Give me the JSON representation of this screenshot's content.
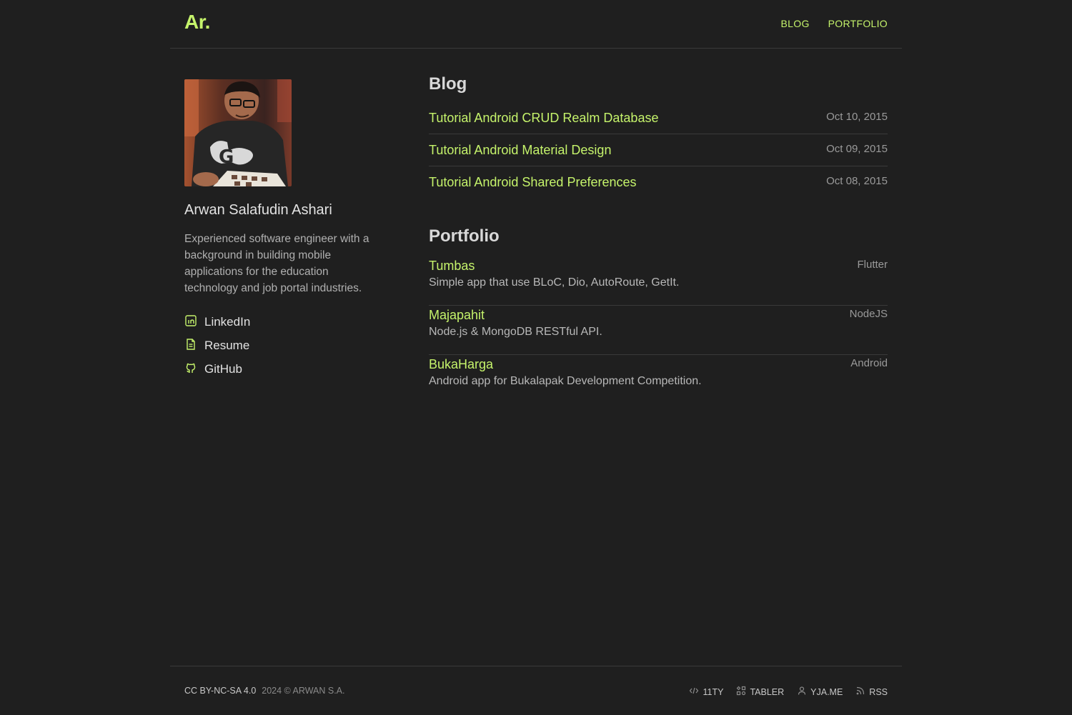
{
  "header": {
    "logo": "Ar.",
    "nav": [
      {
        "label": "BLOG"
      },
      {
        "label": "PORTFOLIO"
      }
    ]
  },
  "profile": {
    "name": "Arwan Salafudin Ashari",
    "bio": "Experienced software engineer with a background in building mobile applications for the education technology and job portal industries.",
    "links": [
      {
        "label": "LinkedIn",
        "icon": "linkedin-icon"
      },
      {
        "label": "Resume",
        "icon": "file-text-icon"
      },
      {
        "label": "GitHub",
        "icon": "github-icon"
      }
    ]
  },
  "blog": {
    "title": "Blog",
    "posts": [
      {
        "title": "Tutorial Android CRUD Realm Database",
        "date": "Oct 10, 2015"
      },
      {
        "title": "Tutorial Android Material Design",
        "date": "Oct 09, 2015"
      },
      {
        "title": "Tutorial Android Shared Preferences",
        "date": "Oct 08, 2015"
      }
    ]
  },
  "portfolio": {
    "title": "Portfolio",
    "projects": [
      {
        "name": "Tumbas",
        "tag": "Flutter",
        "description": "Simple app that use BLoC, Dio, AutoRoute, GetIt."
      },
      {
        "name": "Majapahit",
        "tag": "NodeJS",
        "description": "Node.js & MongoDB RESTful API."
      },
      {
        "name": "BukaHarga",
        "tag": "Android",
        "description": "Android app for Bukalapak Development Competition."
      }
    ]
  },
  "footer": {
    "license": "CC BY-NC-SA 4.0",
    "copyright": "2024 © ARWAN S.A.",
    "links": [
      {
        "label": "11TY",
        "icon": "code-icon"
      },
      {
        "label": "TABLER",
        "icon": "components-icon"
      },
      {
        "label": "YJA.ME",
        "icon": "user-icon"
      },
      {
        "label": "RSS",
        "icon": "rss-icon"
      }
    ]
  },
  "colors": {
    "background": "#1f1f1f",
    "accent": "#c5f36b",
    "divider": "#3a3a3a"
  }
}
